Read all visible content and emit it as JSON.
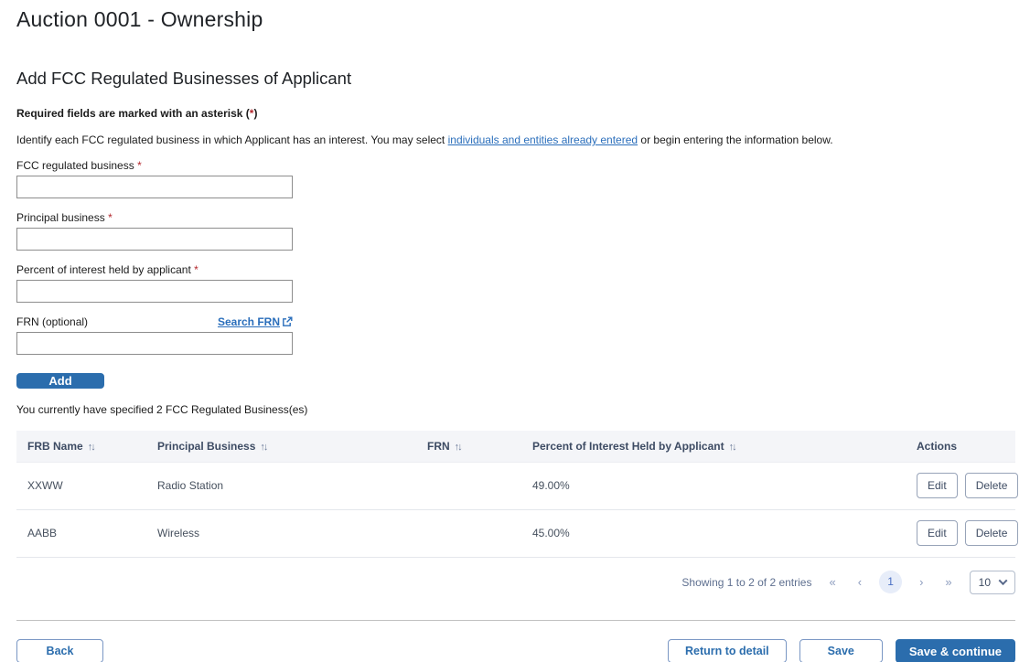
{
  "page": {
    "title": "Auction 0001 - Ownership"
  },
  "ui": {
    "asterisk": "*"
  },
  "colors": {
    "accent": "#2b6dad",
    "link": "#2a6ebb",
    "required_red": "#b3272c",
    "table_header_bg": "#f4f5f8"
  },
  "section": {
    "heading": "Add FCC Regulated Businesses of Applicant",
    "required_note_prefix": "Required fields are marked with an asterisk (",
    "required_note_suffix": ")",
    "instructions_before_link": "Identify each FCC regulated business in which Applicant has an interest. You may select ",
    "instructions_link": "individuals and entities already entered",
    "instructions_after_link": " or begin entering the information below."
  },
  "form": {
    "fields": {
      "frb": {
        "label": "FCC regulated business",
        "value": ""
      },
      "principal": {
        "label": "Principal business",
        "value": ""
      },
      "percent": {
        "label": "Percent of interest held by applicant",
        "value": ""
      },
      "frn": {
        "label": "FRN (optional)",
        "search_link": "Search FRN",
        "value": ""
      }
    },
    "add_button": "Add",
    "count_text": "You currently have specified 2 FCC Regulated Business(es)"
  },
  "table": {
    "sort_icon": "↑↓",
    "columns": [
      {
        "label": "FRB Name"
      },
      {
        "label": "Principal Business"
      },
      {
        "label": "FRN"
      },
      {
        "label": "Percent of Interest Held by Applicant"
      },
      {
        "label": "Actions"
      }
    ],
    "rows": [
      {
        "frb_name": "XXWW",
        "principal_business": "Radio Station",
        "frn": "",
        "percent": "49.00%"
      },
      {
        "frb_name": "AABB",
        "principal_business": "Wireless",
        "frn": "",
        "percent": "45.00%"
      }
    ],
    "actions": {
      "edit": "Edit",
      "delete": "Delete"
    }
  },
  "pagination": {
    "summary": "Showing 1 to 2 of 2 entries",
    "first": "«",
    "prev": "‹",
    "page": "1",
    "next": "›",
    "last": "»",
    "page_size": "10"
  },
  "footer": {
    "back": "Back",
    "return_to_detail": "Return to detail",
    "save": "Save",
    "save_continue": "Save & continue"
  }
}
